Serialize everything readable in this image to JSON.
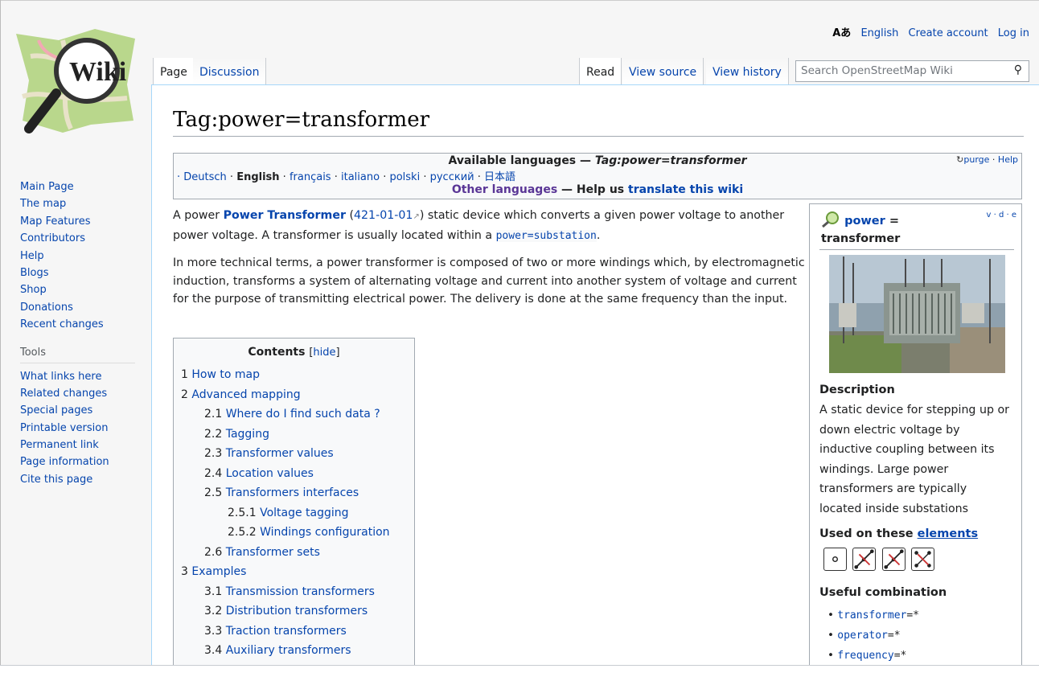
{
  "personal": {
    "language": "English",
    "create_account": "Create account",
    "login": "Log in",
    "lang_icon": "Aあ"
  },
  "tabs": {
    "page": "Page",
    "discussion": "Discussion",
    "read": "Read",
    "view_source": "View source",
    "view_history": "View history"
  },
  "search": {
    "placeholder": "Search OpenStreetMap Wiki"
  },
  "sidebar": {
    "nav": [
      "Main Page",
      "The map",
      "Map Features",
      "Contributors",
      "Help",
      "Blogs",
      "Shop",
      "Donations",
      "Recent changes"
    ],
    "tools_heading": "Tools",
    "tools": [
      "What links here",
      "Related changes",
      "Special pages",
      "Printable version",
      "Permanent link",
      "Page information",
      "Cite this page"
    ]
  },
  "logo": {
    "text": "Wiki"
  },
  "page": {
    "title": "Tag:power=transformer"
  },
  "langbox": {
    "heading_prefix": "Available languages — ",
    "heading_tag": "Tag:power=transformer",
    "purge": "purge",
    "help": "Help",
    "languages": [
      "Deutsch",
      "English",
      "français",
      "italiano",
      "polski",
      "русский",
      "日本語"
    ],
    "current": "English",
    "other_languages": "Other languages",
    "help_us": " — Help us ",
    "translate": "translate this wiki"
  },
  "intro": {
    "p1_a": "A power ",
    "p1_link": "Power Transformer",
    "p1_b": " (",
    "p1_ref": "421-01-01",
    "p1_c": ") static device which converts a given power voltage to another power voltage. A transformer is usually located within a ",
    "p1_code": "power=substation",
    "p1_d": ".",
    "p2": "In more technical terms, a power transformer is composed of two or more windings which, by electromagnetic induction, transforms a system of alternating voltage and current into another system of voltage and current for the purpose of transmitting electrical power. The delivery is done at the same frequency than the input."
  },
  "toc": {
    "title": "Contents",
    "hide": "hide",
    "items": [
      {
        "num": "1",
        "label": "How to map",
        "level": 1
      },
      {
        "num": "2",
        "label": "Advanced mapping",
        "level": 1
      },
      {
        "num": "2.1",
        "label": "Where do I find such data ?",
        "level": 2
      },
      {
        "num": "2.2",
        "label": "Tagging",
        "level": 2
      },
      {
        "num": "2.3",
        "label": "Transformer values",
        "level": 2
      },
      {
        "num": "2.4",
        "label": "Location values",
        "level": 2
      },
      {
        "num": "2.5",
        "label": "Transformers interfaces",
        "level": 2
      },
      {
        "num": "2.5.1",
        "label": "Voltage tagging",
        "level": 3
      },
      {
        "num": "2.5.2",
        "label": "Windings configuration",
        "level": 3
      },
      {
        "num": "2.6",
        "label": "Transformer sets",
        "level": 2
      },
      {
        "num": "3",
        "label": "Examples",
        "level": 1
      },
      {
        "num": "3.1",
        "label": "Transmission transformers",
        "level": 2
      },
      {
        "num": "3.2",
        "label": "Distribution transformers",
        "level": 2
      },
      {
        "num": "3.3",
        "label": "Traction transformers",
        "level": 2
      },
      {
        "num": "3.4",
        "label": "Auxiliary transformers",
        "level": 2
      }
    ]
  },
  "infobox": {
    "vde": "v · d · e",
    "key": "power",
    "eq": " =",
    "value": "transformer",
    "description_h": "Description",
    "description": "A static device for stepping up or down electric voltage by inductive coupling between its windings. Large power transformers are typically located inside substations",
    "used_on": "Used on these ",
    "elements": "elements",
    "useful": "Useful combination",
    "combinations": [
      "transformer",
      "operator",
      "frequency"
    ],
    "combo_suffix": "=*"
  }
}
